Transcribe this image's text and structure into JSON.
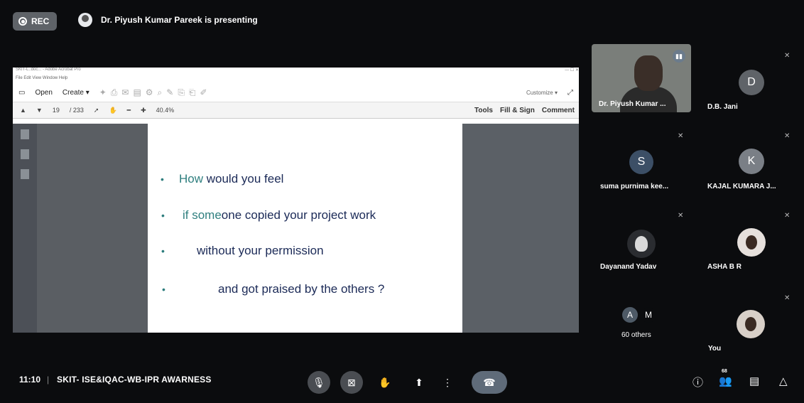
{
  "rec_label": "REC",
  "presenting": "Dr. Piyush Kumar Pareek is presenting",
  "share": {
    "window_title": "SKIT-L..doc... - Adobe Acrobat Pro",
    "menu": "File  Edit  View  Window  Help",
    "open": "Open",
    "create": "Create",
    "customize": "Customize",
    "page": "19",
    "pages": "/ 233",
    "zoom": "40.4%",
    "tools": "Tools",
    "fill_sign": "Fill & Sign",
    "comment": "Comment",
    "line1_a": "How",
    "line1_b": " would you feel",
    "line2_a": "if some",
    "line2_b": "one copied your project work",
    "line3": "without your permission",
    "line4": "and got praised by the others ?"
  },
  "participants": {
    "presenter": "Dr. Piyush Kumar ...",
    "p1_initial": "D",
    "p1_name": "D.B. Jani",
    "p1_color": "#5f6368",
    "p2_initial": "S",
    "p2_name": "suma purnima kee...",
    "p2_color": "#3c4f66",
    "p3_initial": "K",
    "p3_name": "KAJAL KUMARA J...",
    "p3_color": "#7a7f86",
    "p4_name": "Dayanand Yadav",
    "p5_name": "ASHA B R",
    "others_a": "A",
    "others_m": "M",
    "others_label": "60 others",
    "you": "You"
  },
  "bottom": {
    "time": "11:10",
    "separator": "|",
    "meeting": "SKIT- ISE&IQAC-WB-IPR AWARNESS",
    "people_count": "68"
  },
  "colors": {
    "control_grey": "#4a4d52",
    "hangup": "#5f6b79"
  }
}
